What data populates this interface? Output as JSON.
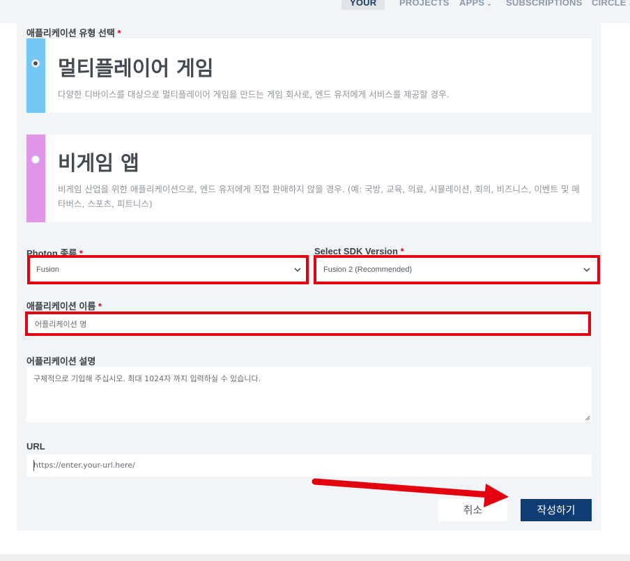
{
  "nav": {
    "items": [
      {
        "label": "YOUR",
        "active": true
      },
      {
        "label": "PROJECTS"
      },
      {
        "label": "APPS",
        "dropdown": true
      },
      {
        "label": "SUBSCRIPTIONS"
      },
      {
        "label": "CIRCLE",
        "dropdown": true
      }
    ]
  },
  "app_type": {
    "label": "애플리케이션 유형 선택",
    "required_mark": "*",
    "options": [
      {
        "title": "멀티플레이어 게임",
        "description": "다양한 디바이스를 대상으로 멀티플레이어 게임을 만드는 게임 회사로, 엔드 유저에게 서비스를 제공할 경우.",
        "selected": true,
        "color": "#74c8f5"
      },
      {
        "title": "비게임 앱",
        "description": "비게임 산업을 위한 애플리케이션으로, 엔드 유저에게 직접 판매하지 않을 경우. (예: 국방, 교육, 의료, 시뮬레이션, 회의, 비즈니스, 이벤트 및 메타버스, 스포츠, 피트니스)",
        "selected": false,
        "color": "#e095e8"
      }
    ]
  },
  "photon_type": {
    "label": "Photon 종류",
    "required_mark": "*",
    "value": "Fusion"
  },
  "sdk_version": {
    "label": "Select SDK Version",
    "required_mark": "*",
    "value": "Fusion 2 (Recommended)"
  },
  "app_name": {
    "label": "애플리케이션 이름",
    "required_mark": "*",
    "placeholder": "어플리케이션 명"
  },
  "app_description": {
    "label": "어플리케이션 설명",
    "placeholder": "구체적으로 기입해 주십시오. 최대 1024자 까지 입력하실 수 있습니다."
  },
  "url": {
    "label": "URL",
    "placeholder": "https://enter.your-url.here/"
  },
  "buttons": {
    "cancel": "취소",
    "submit": "작성하기"
  },
  "colors": {
    "accent": "#0f3d73",
    "required": "#e0002a",
    "highlight": "#e3000f"
  }
}
